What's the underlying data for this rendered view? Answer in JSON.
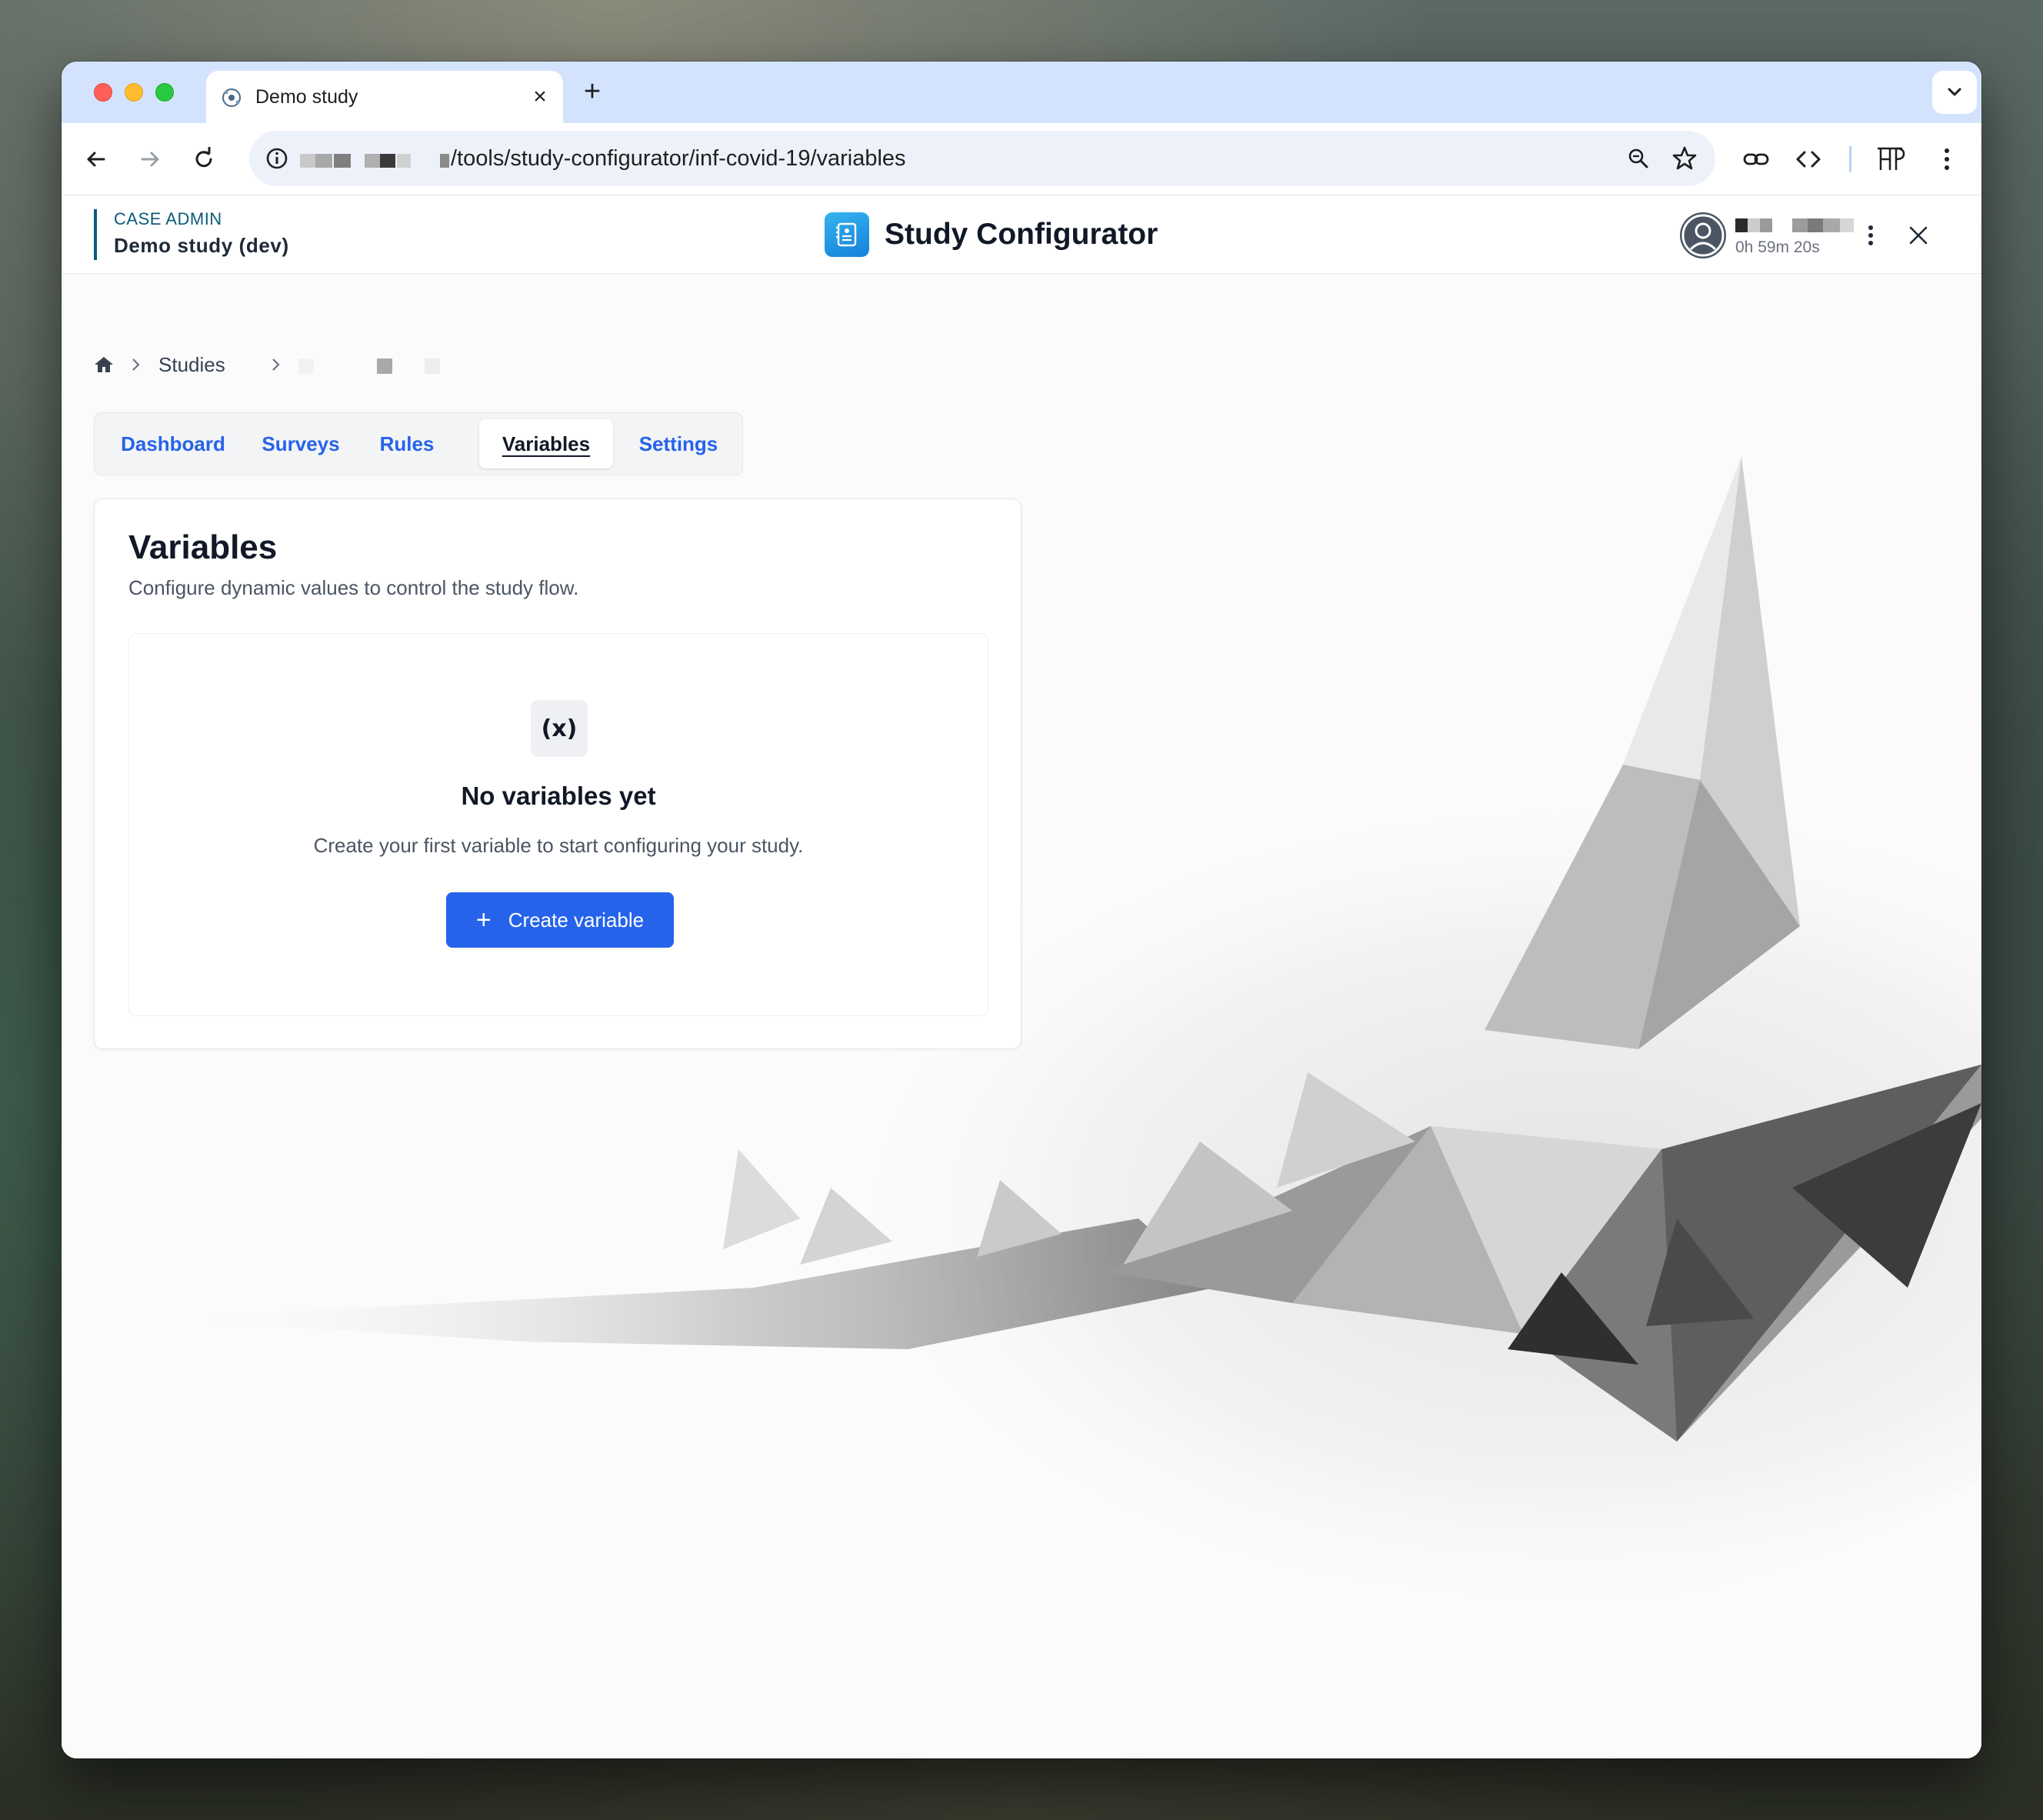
{
  "browser": {
    "tab_title": "Demo study",
    "url_visible": "/tools/study-configurator/inf-covid-19/variables",
    "url_host_redacted": true
  },
  "app": {
    "kicker": "CASE ADMIN",
    "project": "Demo study (dev)",
    "title": "Study Configurator",
    "session_time": "0h 59m 20s",
    "accent_color": "#0b5c7a"
  },
  "breadcrumb": {
    "home_icon": "home-icon",
    "items": [
      "Studies"
    ]
  },
  "tabs": [
    {
      "label": "Dashboard",
      "active": false
    },
    {
      "label": "Surveys",
      "active": false
    },
    {
      "label": "Rules",
      "active": false
    },
    {
      "label": "Variables",
      "active": true
    },
    {
      "label": "Settings",
      "active": false
    }
  ],
  "main": {
    "title": "Variables",
    "description": "Configure dynamic values to control the study flow.",
    "empty_state": {
      "icon": "function-variable-icon",
      "icon_glyph": "(x)",
      "title": "No variables yet",
      "description": "Create your first variable to start configuring your study.",
      "button_label": "Create variable",
      "button_color": "#2563eb"
    }
  }
}
